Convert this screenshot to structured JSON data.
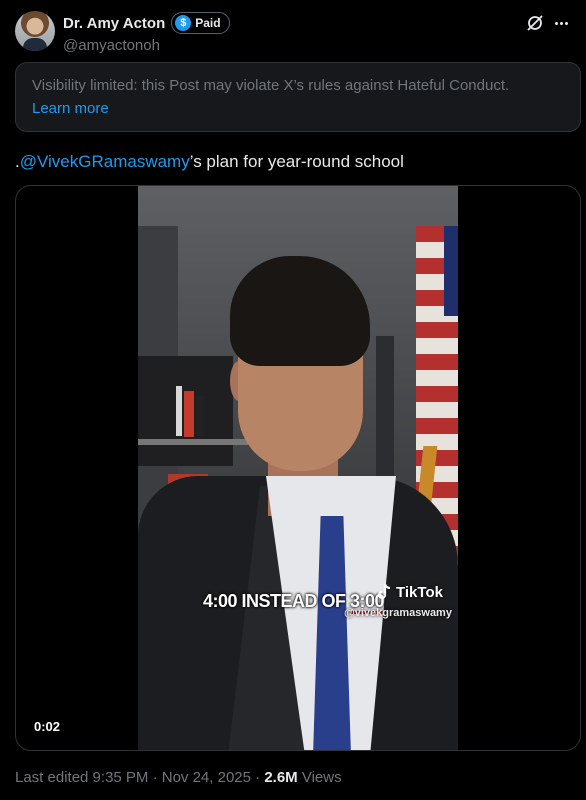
{
  "author": {
    "display_name": "Dr. Amy Acton",
    "badge_label": "Paid",
    "badge_icon": "dollar-icon",
    "handle": "@amyactonoh"
  },
  "notice": {
    "text": "Visibility limited: this Post may violate X’s rules against Hateful Conduct.",
    "link": "Learn more"
  },
  "post": {
    "prefix": ".",
    "mention": "@VivekGRamaswamy",
    "suffix": "’s plan for year-round school"
  },
  "video": {
    "caption_before": "4:00 INSTEAD OF ",
    "caption_highlight": "3:00",
    "watermark": "TikTok",
    "watermark_handle": "@vivekgramaswamy",
    "elapsed": "0:02"
  },
  "meta": {
    "edited": "Last edited 9:35 PM · Nov 24, 2025 · ",
    "views_count": "2.6M",
    "views_label": " Views"
  },
  "colors": {
    "accent": "#1d9bf0",
    "background": "#000000",
    "muted": "#71767b"
  }
}
